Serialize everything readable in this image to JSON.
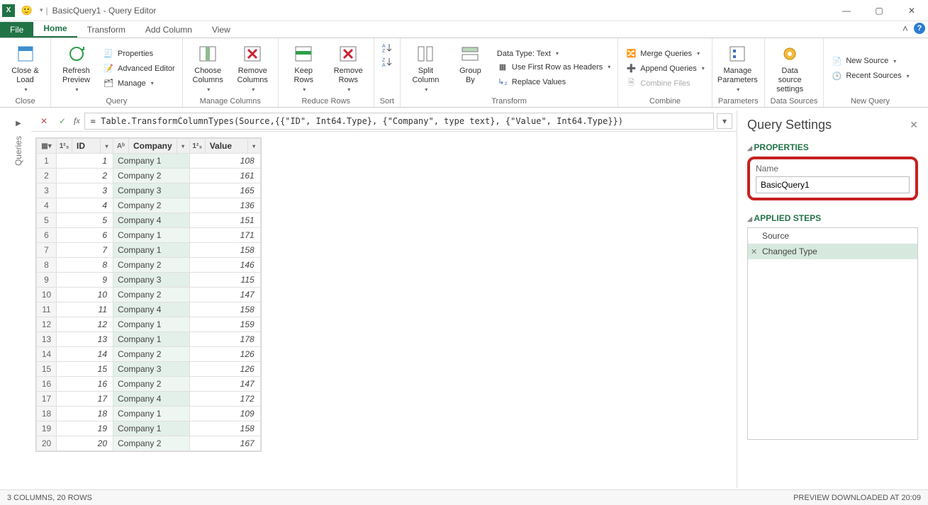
{
  "window": {
    "title": "BasicQuery1 - Query Editor"
  },
  "tabs": {
    "file": "File",
    "home": "Home",
    "transform": "Transform",
    "addcol": "Add Column",
    "view": "View"
  },
  "ribbon": {
    "close": {
      "closeload": "Close &\nLoad",
      "group": "Close"
    },
    "query": {
      "refresh": "Refresh\nPreview",
      "properties": "Properties",
      "advanced": "Advanced Editor",
      "manage": "Manage",
      "group": "Query"
    },
    "managecols": {
      "choose": "Choose\nColumns",
      "remove": "Remove\nColumns",
      "group": "Manage Columns"
    },
    "reducerows": {
      "keep": "Keep\nRows",
      "removerows": "Remove\nRows",
      "group": "Reduce Rows"
    },
    "sort": {
      "group": "Sort"
    },
    "transform": {
      "split": "Split\nColumn",
      "groupby": "Group\nBy",
      "datatype": "Data Type: Text",
      "firstrow": "Use First Row as Headers",
      "replace": "Replace Values",
      "group": "Transform"
    },
    "combine": {
      "merge": "Merge Queries",
      "append": "Append Queries",
      "combinefiles": "Combine Files",
      "group": "Combine"
    },
    "params": {
      "manageparams": "Manage\nParameters",
      "group": "Parameters"
    },
    "datasources": {
      "dssettings": "Data source\nsettings",
      "group": "Data Sources"
    },
    "newquery": {
      "newsource": "New Source",
      "recent": "Recent Sources",
      "group": "New Query"
    }
  },
  "queries_label": "Queries",
  "formula": "= Table.TransformColumnTypes(Source,{{\"ID\", Int64.Type}, {\"Company\", type text}, {\"Value\", Int64.Type}})",
  "columns": {
    "id": "ID",
    "company": "Company",
    "value": "Value"
  },
  "rows": [
    {
      "n": 1,
      "id": 1,
      "company": "Company 1",
      "value": 108
    },
    {
      "n": 2,
      "id": 2,
      "company": "Company 2",
      "value": 161
    },
    {
      "n": 3,
      "id": 3,
      "company": "Company 3",
      "value": 165
    },
    {
      "n": 4,
      "id": 4,
      "company": "Company 2",
      "value": 136
    },
    {
      "n": 5,
      "id": 5,
      "company": "Company 4",
      "value": 151
    },
    {
      "n": 6,
      "id": 6,
      "company": "Company 1",
      "value": 171
    },
    {
      "n": 7,
      "id": 7,
      "company": "Company 1",
      "value": 158
    },
    {
      "n": 8,
      "id": 8,
      "company": "Company 2",
      "value": 146
    },
    {
      "n": 9,
      "id": 9,
      "company": "Company 3",
      "value": 115
    },
    {
      "n": 10,
      "id": 10,
      "company": "Company 2",
      "value": 147
    },
    {
      "n": 11,
      "id": 11,
      "company": "Company 4",
      "value": 158
    },
    {
      "n": 12,
      "id": 12,
      "company": "Company 1",
      "value": 159
    },
    {
      "n": 13,
      "id": 13,
      "company": "Company 1",
      "value": 178
    },
    {
      "n": 14,
      "id": 14,
      "company": "Company 2",
      "value": 126
    },
    {
      "n": 15,
      "id": 15,
      "company": "Company 3",
      "value": 126
    },
    {
      "n": 16,
      "id": 16,
      "company": "Company 2",
      "value": 147
    },
    {
      "n": 17,
      "id": 17,
      "company": "Company 4",
      "value": 172
    },
    {
      "n": 18,
      "id": 18,
      "company": "Company 1",
      "value": 109
    },
    {
      "n": 19,
      "id": 19,
      "company": "Company 1",
      "value": 158
    },
    {
      "n": 20,
      "id": 20,
      "company": "Company 2",
      "value": 167
    }
  ],
  "settings": {
    "title": "Query Settings",
    "properties_hdr": "PROPERTIES",
    "name_label": "Name",
    "name_value": "BasicQuery1",
    "steps_hdr": "APPLIED STEPS",
    "steps": [
      "Source",
      "Changed Type"
    ]
  },
  "status": {
    "left": "3 COLUMNS, 20 ROWS",
    "right": "PREVIEW DOWNLOADED AT 20:09"
  }
}
